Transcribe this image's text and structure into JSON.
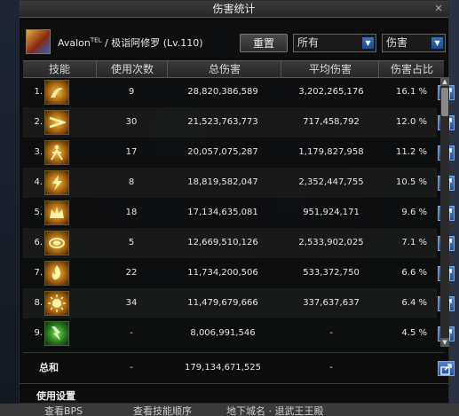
{
  "window": {
    "title": "伤害统计"
  },
  "player": {
    "name": "Avalon",
    "tag": "TEL",
    "rest": " / 极诣阿修罗 (Lv.110)"
  },
  "controls": {
    "reset_label": "重置",
    "filter_select": "所有",
    "type_select": "伤害"
  },
  "columns": {
    "skill": "技能",
    "count": "使用次数",
    "total": "总伤害",
    "avg": "平均伤害",
    "pct": "伤害占比"
  },
  "rows": [
    {
      "num": "1.",
      "count": "9",
      "total": "28,820,386,589",
      "avg": "3,202,265,176",
      "pct": "16.1 %",
      "icon": "fire-wave-skill-icon"
    },
    {
      "num": "2.",
      "count": "30",
      "total": "21,523,763,773",
      "avg": "717,458,792",
      "pct": "12.0 %",
      "icon": "triple-slash-skill-icon"
    },
    {
      "num": "3.",
      "count": "17",
      "total": "20,057,075,287",
      "avg": "1,179,827,958",
      "pct": "11.2 %",
      "icon": "figure-dash-skill-icon"
    },
    {
      "num": "4.",
      "count": "8",
      "total": "18,819,582,047",
      "avg": "2,352,447,755",
      "pct": "10.5 %",
      "icon": "lightning-fist-skill-icon"
    },
    {
      "num": "5.",
      "count": "18",
      "total": "17,134,635,081",
      "avg": "951,924,171",
      "pct": "9.6 %",
      "icon": "crown-burst-skill-icon"
    },
    {
      "num": "6.",
      "count": "5",
      "total": "12,669,510,126",
      "avg": "2,533,902,025",
      "pct": "7.1 %",
      "icon": "ring-wave-skill-icon"
    },
    {
      "num": "7.",
      "count": "22",
      "total": "11,734,200,506",
      "avg": "533,372,750",
      "pct": "6.6 %",
      "icon": "flame-slash-skill-icon"
    },
    {
      "num": "8.",
      "count": "34",
      "total": "11,479,679,666",
      "avg": "337,637,637",
      "pct": "6.4 %",
      "icon": "sun-face-skill-icon"
    },
    {
      "num": "9.",
      "count": "-",
      "total": "8,006,991,546",
      "avg": "-",
      "pct": "4.5 %",
      "icon": "green-lightning-skill-icon"
    }
  ],
  "total": {
    "label": "总和",
    "count": "-",
    "total": "179,134,671,525",
    "avg": "-"
  },
  "footer": {
    "settings_label": "使用设置"
  },
  "background": {
    "bottom_text_1": "查看BPS",
    "bottom_text_2": "查看技能顺序",
    "bottom_text_3": "地下城名 · 退武王王殿"
  },
  "colors": {
    "accent": "#f2c040",
    "share_button": "#2f6ab8"
  }
}
